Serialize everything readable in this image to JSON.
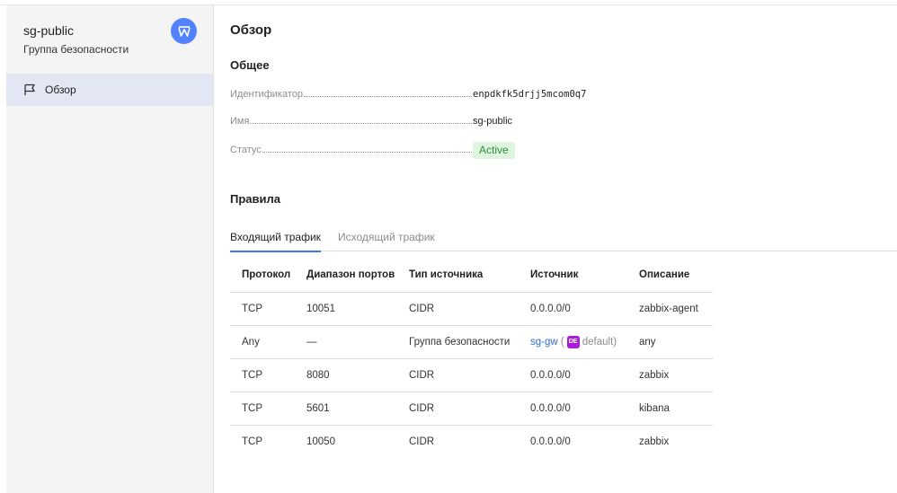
{
  "sidebar": {
    "title": "sg-public",
    "subtitle": "Группа безопасности",
    "badge_icon": "security-group-icon",
    "items": [
      {
        "label": "Обзор",
        "icon": "flag-icon",
        "active": true
      }
    ]
  },
  "main": {
    "title": "Обзор",
    "general": {
      "heading": "Общее",
      "properties": [
        {
          "key": "Идентификатор",
          "value": "enpdkfk5drjj5mcom0q7"
        },
        {
          "key": "Имя",
          "value": "sg-public"
        },
        {
          "key": "Статус",
          "value": "Active"
        }
      ]
    },
    "rules": {
      "heading": "Правила",
      "tabs": [
        {
          "label": "Входящий трафик",
          "active": true
        },
        {
          "label": "Исходящий трафик",
          "active": false
        }
      ],
      "columns": [
        "Протокол",
        "Диапазон портов",
        "Тип источника",
        "Источник",
        "Описание"
      ],
      "rows": [
        {
          "protocol": "TCP",
          "ports": "10051",
          "source_type": "CIDR",
          "source": "0.0.0.0/0",
          "description": "zabbix-agent"
        },
        {
          "protocol": "Any",
          "ports": "—",
          "source_type": "Группа безопасности",
          "source_link": "sg-gw",
          "paren_open": "(",
          "folder_badge": "DE",
          "folder_name": "default",
          "paren_close": ")",
          "description": "any"
        },
        {
          "protocol": "TCP",
          "ports": "8080",
          "source_type": "CIDR",
          "source": "0.0.0.0/0",
          "description": "zabbix"
        },
        {
          "protocol": "TCP",
          "ports": "5601",
          "source_type": "CIDR",
          "source": "0.0.0.0/0",
          "description": "kibana"
        },
        {
          "protocol": "TCP",
          "ports": "10050",
          "source_type": "CIDR",
          "source": "0.0.0.0/0",
          "description": "zabbix"
        }
      ]
    }
  },
  "colors": {
    "accent": "#3b7bd8",
    "badge_blue": "#5282ff",
    "status_green_bg": "#dff5df",
    "status_green_text": "#2f8d3b",
    "folder_purple": "#a91cd8"
  }
}
